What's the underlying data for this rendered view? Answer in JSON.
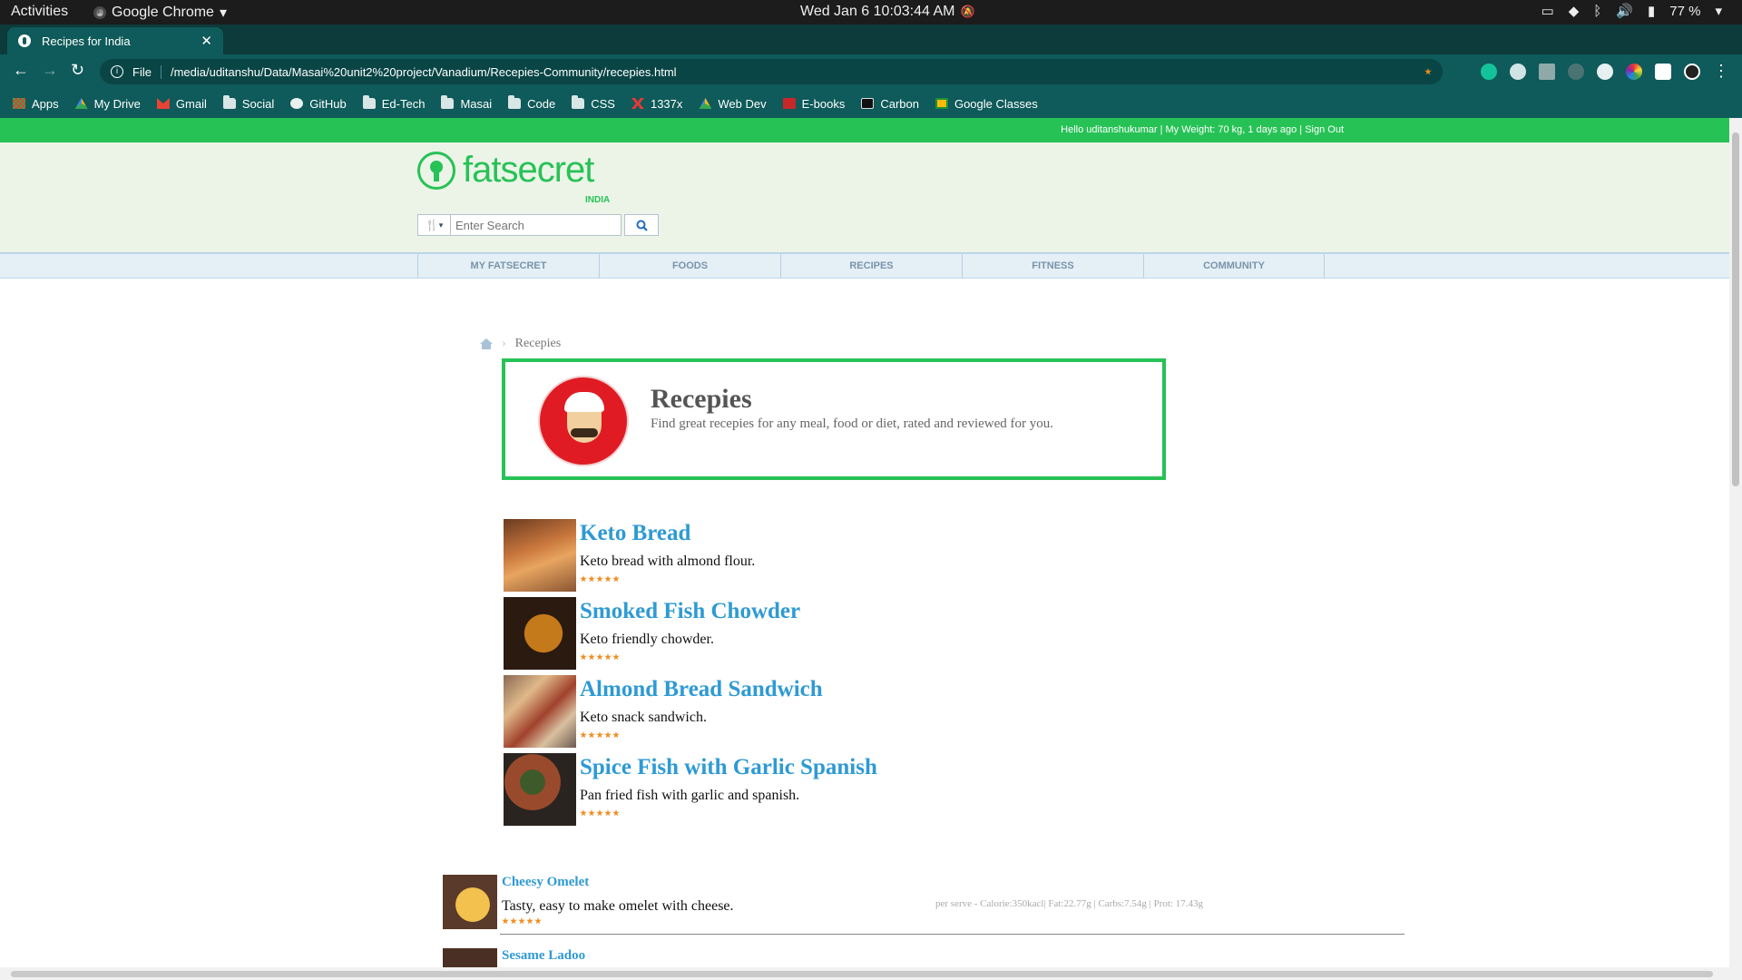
{
  "system_bar": {
    "activities": "Activities",
    "app_name": "Google Chrome",
    "clock": "Wed Jan 6  10:03:44 AM",
    "battery": "77 %"
  },
  "browser": {
    "tab_title": "Recipes for India",
    "scheme_label": "File",
    "url": "/media/uditanshu/Data/Masai%20unit2%20project/Vanadium/Recepies-Community/recepies.html",
    "bookmarks": [
      {
        "label": "Apps",
        "icon": "apps-grid-icon"
      },
      {
        "label": "My Drive",
        "icon": "drive-icon"
      },
      {
        "label": "Gmail",
        "icon": "gmail-icon"
      },
      {
        "label": "Social",
        "icon": "folder-icon"
      },
      {
        "label": "GitHub",
        "icon": "github-icon"
      },
      {
        "label": "Ed-Tech",
        "icon": "folder-icon"
      },
      {
        "label": "Masai",
        "icon": "folder-icon"
      },
      {
        "label": "Code",
        "icon": "folder-icon"
      },
      {
        "label": "CSS",
        "icon": "folder-icon"
      },
      {
        "label": "1337x",
        "icon": "1337x-icon"
      },
      {
        "label": "Web Dev",
        "icon": "drive-icon"
      },
      {
        "label": "E-books",
        "icon": "ebooks-icon"
      },
      {
        "label": "Carbon",
        "icon": "carbon-icon"
      },
      {
        "label": "Google Classes",
        "icon": "classroom-icon"
      }
    ]
  },
  "site": {
    "user_bar": "Hello uditanshukumar | My Weight: 70 kg, 1 days ago | Sign Out",
    "logo_text": "fatsecret",
    "logo_region": "INDIA",
    "search_placeholder": "Enter Search",
    "nav": [
      "MY FATSECRET",
      "FOODS",
      "RECIPES",
      "FITNESS",
      "COMMUNITY"
    ],
    "breadcrumb_current": "Recepies",
    "hero": {
      "title": "Recepies",
      "subtitle": "Find great recepies for any meal, food or diet, rated and reviewed for you."
    },
    "featured": [
      {
        "title": "Keto Bread",
        "desc": "Keto bread with almond flour.",
        "rating": 5,
        "img": "keto-bread-photo"
      },
      {
        "title": "Smoked Fish Chowder",
        "desc": "Keto friendly chowder.",
        "rating": 5,
        "img": "fish-chowder-photo"
      },
      {
        "title": "Almond Bread Sandwich",
        "desc": "Keto snack sandwich.",
        "rating": 5,
        "img": "sandwich-photo"
      },
      {
        "title": "Spice Fish with Garlic Spanish",
        "desc": "Pan fried fish with garlic and spanish.",
        "rating": 5,
        "img": "spice-fish-photo"
      }
    ],
    "recipes": [
      {
        "title": "Cheesy Omelet",
        "desc": "Tasty, easy to make omelet with cheese.",
        "nutrition": "per serve - Calorie:350kacl| Fat:22.77g | Carbs:7.54g | Prot: 17.43g",
        "rating": 5
      },
      {
        "title": "Sesame Ladoo",
        "desc": "",
        "nutrition": "",
        "rating": 0
      }
    ],
    "colors": {
      "brand_green": "#27c256",
      "link_blue": "#2e9ad4",
      "star_orange": "#f08c1e",
      "chrome_teal": "#0f5a5a"
    }
  }
}
